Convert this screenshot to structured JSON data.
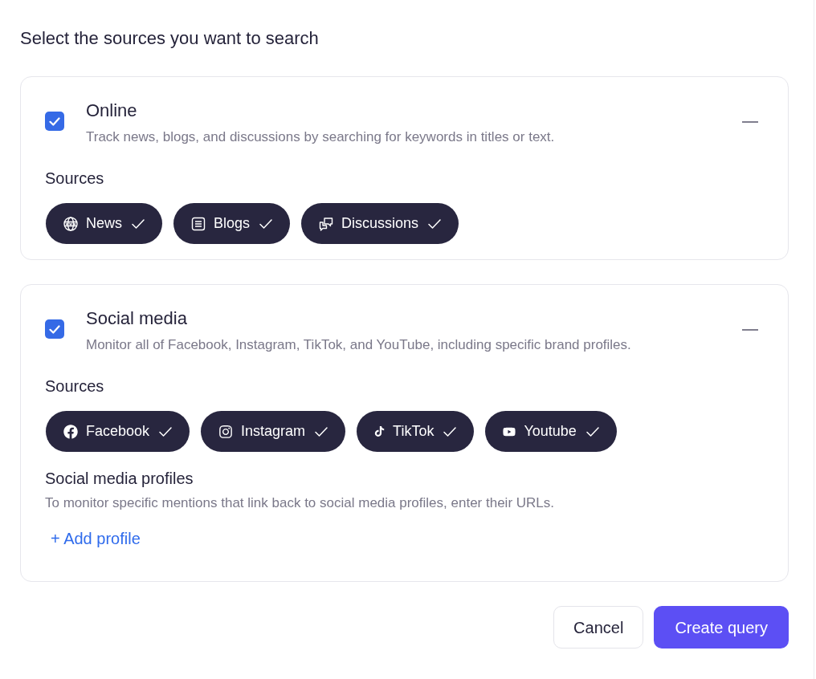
{
  "title": "Select the sources you want to search",
  "groups": [
    {
      "title": "Online",
      "checked": true,
      "expanded": true,
      "description": "Track news, blogs, and discussions by searching for keywords in titles or text.",
      "sources_label": "Sources",
      "sources": [
        {
          "label": "News",
          "kind": "web",
          "selected": true
        },
        {
          "label": "Blogs",
          "kind": "blog",
          "selected": true
        },
        {
          "label": "Discussions",
          "kind": "discussion",
          "selected": true
        }
      ]
    },
    {
      "title": "Social media",
      "checked": true,
      "expanded": true,
      "description": "Monitor all of Facebook, Instagram, TikTok, and YouTube, including specific brand profiles.",
      "sources_label": "Sources",
      "sources": [
        {
          "label": "Facebook",
          "kind": "facebook",
          "selected": true
        },
        {
          "label": "Instagram",
          "kind": "instagram",
          "selected": true
        },
        {
          "label": "TikTok",
          "kind": "tiktok",
          "selected": true
        },
        {
          "label": "Youtube",
          "kind": "youtube",
          "selected": true
        }
      ],
      "profiles": {
        "title": "Social media profiles",
        "description": "To monitor specific mentions that link back to social media profiles, enter their URLs.",
        "add_link": "+ Add profile"
      }
    }
  ],
  "buttons": [
    {
      "label": "Cancel",
      "kind": "secondary"
    },
    {
      "label": "Create query",
      "kind": "primary"
    }
  ]
}
